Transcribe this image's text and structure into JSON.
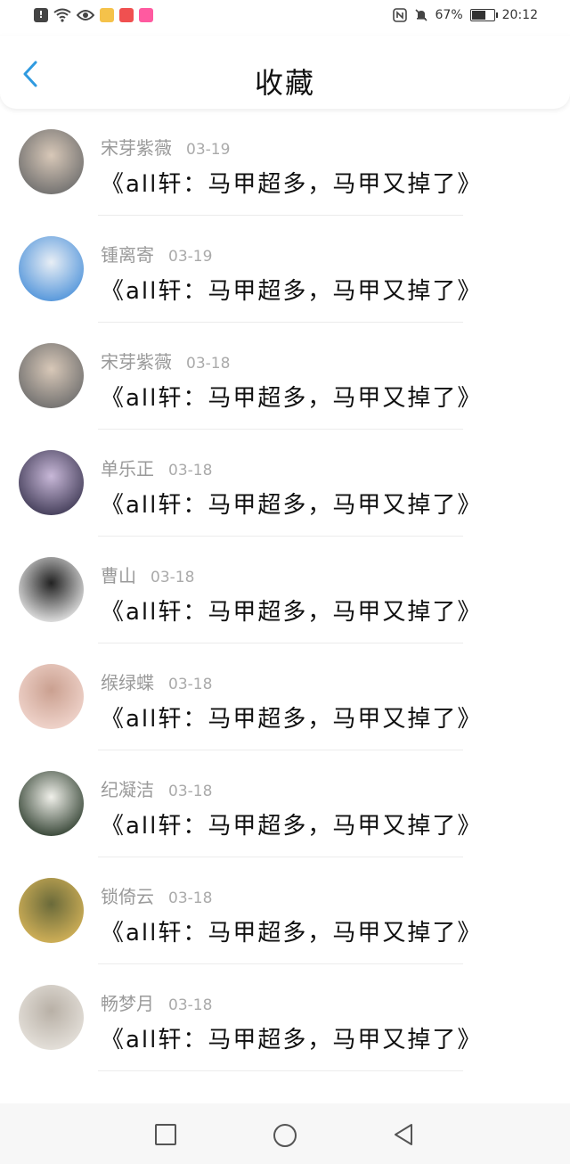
{
  "status_bar": {
    "left_icons": [
      "alert-icon",
      "wifi-icon",
      "eye-icon",
      "app-icon-1",
      "app-icon-2",
      "app-icon-3"
    ],
    "right_icons": [
      "nfc-icon",
      "mute-bell-icon"
    ],
    "battery_percent": "67%",
    "battery_level": 0.67,
    "time": "20:12"
  },
  "header": {
    "back_icon": "chevron-left-icon",
    "title": "收藏",
    "accent_color": "#2f9ae0"
  },
  "items": [
    {
      "name": "宋芽紫薇",
      "date": "03-19",
      "content": "《all轩：马甲超多，马甲又掉了》",
      "avatar_colors": [
        "#6b6b6b",
        "#d8c8b8"
      ]
    },
    {
      "name": "锺离寄",
      "date": "03-19",
      "content": "《all轩：马甲超多，马甲又掉了》",
      "avatar_colors": [
        "#4a90d9",
        "#e8eef5"
      ]
    },
    {
      "name": "宋芽紫薇",
      "date": "03-18",
      "content": "《all轩：马甲超多，马甲又掉了》",
      "avatar_colors": [
        "#6b6b6b",
        "#d8c8b8"
      ]
    },
    {
      "name": "单乐正",
      "date": "03-18",
      "content": "《all轩：马甲超多，马甲又掉了》",
      "avatar_colors": [
        "#3a3550",
        "#c8b8d8"
      ]
    },
    {
      "name": "曹山",
      "date": "03-18",
      "content": "《all轩：马甲超多，马甲又掉了》",
      "avatar_colors": [
        "#f0f0f0",
        "#222222"
      ]
    },
    {
      "name": "缑绿蝶",
      "date": "03-18",
      "content": "《all轩：马甲超多，马甲又掉了》",
      "avatar_colors": [
        "#f3d8d0",
        "#caa090"
      ]
    },
    {
      "name": "纪凝洁",
      "date": "03-18",
      "content": "《all轩：马甲超多，马甲又掉了》",
      "avatar_colors": [
        "#2a3a2a",
        "#f0f0ea"
      ]
    },
    {
      "name": "锁倚云",
      "date": "03-18",
      "content": "《all轩：马甲超多，马甲又掉了》",
      "avatar_colors": [
        "#d9b65a",
        "#6a6a3a"
      ]
    },
    {
      "name": "畅梦月",
      "date": "03-18",
      "content": "《all轩：马甲超多，马甲又掉了》",
      "avatar_colors": [
        "#e8e4de",
        "#b8b0a6"
      ]
    }
  ],
  "nav": {
    "recents_icon": "square-icon",
    "home_icon": "circle-icon",
    "back_icon": "triangle-back-icon"
  }
}
